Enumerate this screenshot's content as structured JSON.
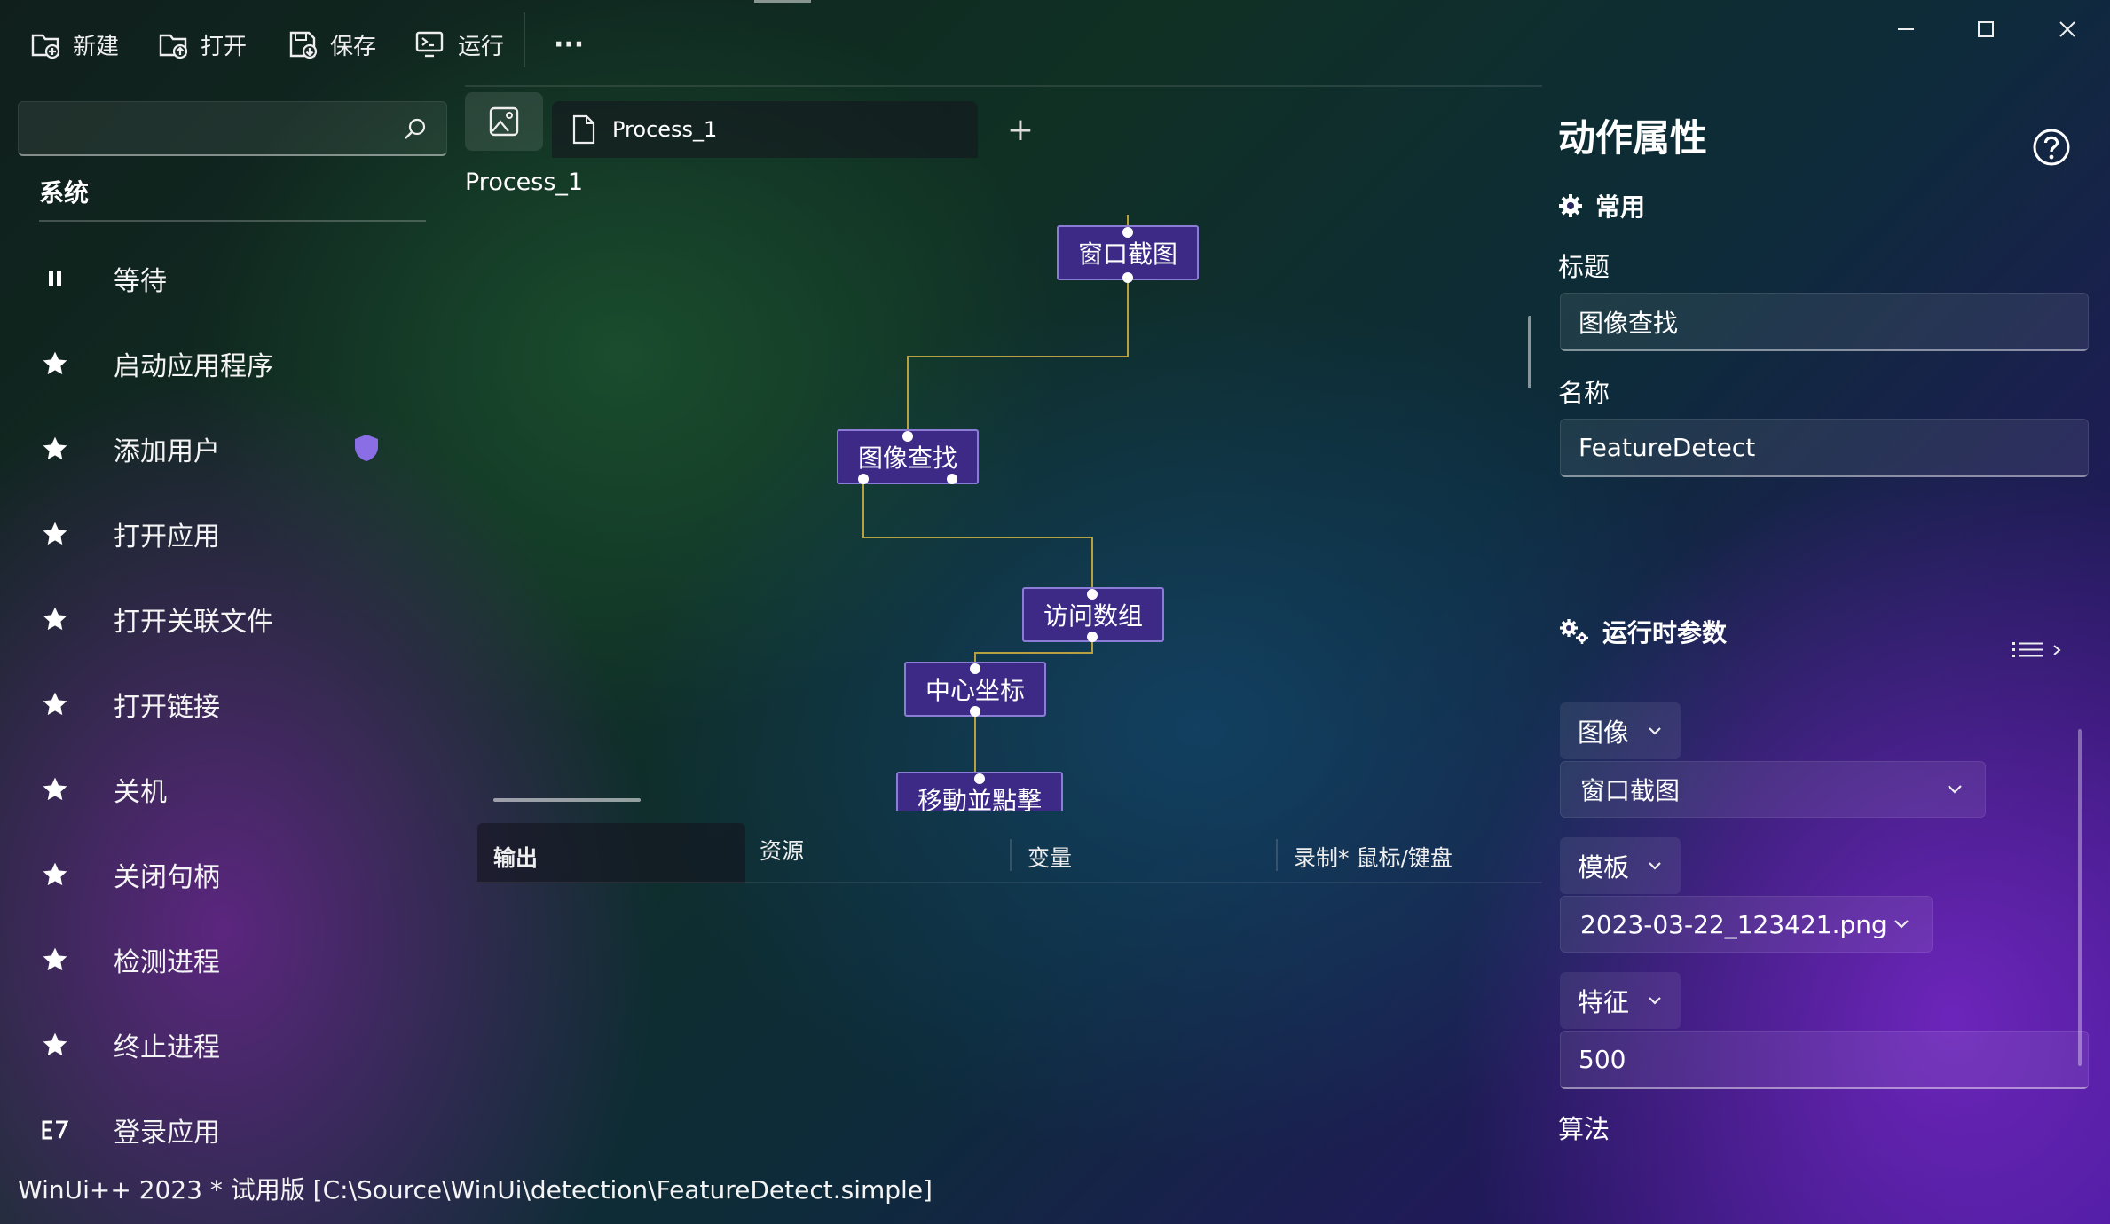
{
  "toolbar": {
    "new_label": "新建",
    "open_label": "打开",
    "save_label": "保存",
    "run_label": "运行",
    "more_label": "···"
  },
  "search": {
    "placeholder": ""
  },
  "sidebar": {
    "section": "系统",
    "items": [
      {
        "label": "等待",
        "icon": "pause-icon"
      },
      {
        "label": "启动应用程序",
        "icon": "star-icon"
      },
      {
        "label": "添加用户",
        "icon": "star-icon",
        "badge": "shield-icon"
      },
      {
        "label": "打开应用",
        "icon": "star-icon"
      },
      {
        "label": "打开关联文件",
        "icon": "star-icon"
      },
      {
        "label": "打开链接",
        "icon": "star-icon"
      },
      {
        "label": "关机",
        "icon": "star-icon"
      },
      {
        "label": "关闭句柄",
        "icon": "star-icon"
      },
      {
        "label": "检测进程",
        "icon": "star-icon"
      },
      {
        "label": "终止进程",
        "icon": "star-icon"
      },
      {
        "label": "登录应用",
        "icon": "e7-icon"
      }
    ]
  },
  "tabs": {
    "doc_tab": "Process_1",
    "add": "+"
  },
  "canvas": {
    "title": "Process_1",
    "nodes": [
      "窗口截图",
      "图像查找",
      "访问数组",
      "中心坐标",
      "移動並點擊"
    ]
  },
  "bottom_tabs": [
    "输出",
    "资源",
    "变量",
    "录制* 鼠标/键盘"
  ],
  "properties": {
    "title": "动作属性",
    "common_label": "常用",
    "title_field_label": "标题",
    "title_value": "图像查找",
    "name_field_label": "名称",
    "name_value": "FeatureDetect",
    "runtime_label": "运行时参数",
    "params": [
      {
        "chip": "图像",
        "value": "窗口截图"
      },
      {
        "chip": "模板",
        "value": "2023-03-22_123421.png"
      },
      {
        "chip": "特征",
        "value": "500"
      }
    ],
    "algorithm_label": "算法"
  },
  "status_bar": "WinUi++ 2023 * 试用版 [C:\\Source\\WinUi\\detection\\FeatureDetect.simple]",
  "colors": {
    "node_fill": "#3d2a86",
    "node_border": "#8b7dd6",
    "connector": "#b8a040",
    "shield": "#8a6ee6"
  }
}
